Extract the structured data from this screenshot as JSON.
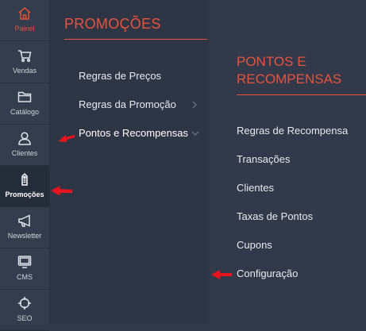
{
  "rail": {
    "items": [
      {
        "label": "Painel",
        "icon": "home-icon"
      },
      {
        "label": "Vendas",
        "icon": "cart-icon"
      },
      {
        "label": "Catálogo",
        "icon": "folder-icon"
      },
      {
        "label": "Clientes",
        "icon": "user-icon"
      },
      {
        "label": "Promoções",
        "icon": "tag-icon"
      },
      {
        "label": "Newsletter",
        "icon": "megaphone-icon"
      },
      {
        "label": "CMS",
        "icon": "monitor-icon"
      },
      {
        "label": "SEO",
        "icon": "crosshair-icon"
      }
    ]
  },
  "promocoes": {
    "title": "PROMOÇÕES",
    "items": [
      {
        "label": "Regras de Preços"
      },
      {
        "label": "Regras da Promoção"
      },
      {
        "label": "Pontos e Recompensas"
      }
    ]
  },
  "pontos": {
    "title_line1": "PONTOS E",
    "title_line2": "RECOMPENSAS",
    "items": [
      {
        "label": "Regras de Recompensa"
      },
      {
        "label": "Transações"
      },
      {
        "label": "Clientes"
      },
      {
        "label": "Taxas de Pontos"
      },
      {
        "label": "Cupons"
      },
      {
        "label": "Configuração"
      }
    ]
  },
  "colors": {
    "accent": "#e8533c",
    "annotation_arrow": "#e8131d"
  }
}
